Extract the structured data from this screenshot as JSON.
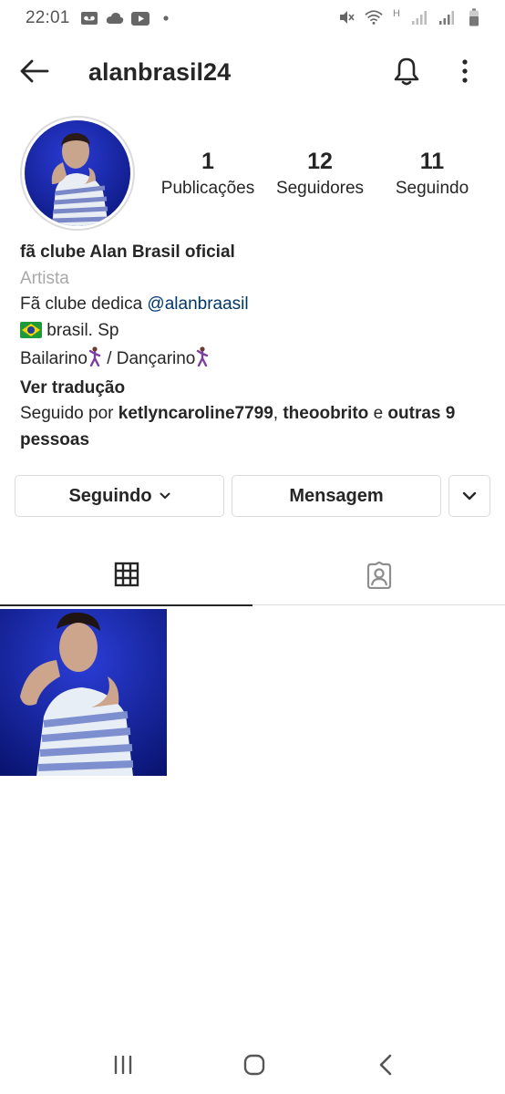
{
  "status_bar": {
    "time": "22:01",
    "network_label": "H"
  },
  "header": {
    "username": "alanbrasil24"
  },
  "stats": [
    {
      "count": "1",
      "label": "Publicações"
    },
    {
      "count": "12",
      "label": "Seguidores"
    },
    {
      "count": "11",
      "label": "Seguindo"
    }
  ],
  "bio": {
    "name": "fã clube Alan Brasil oficial",
    "category": "Artista",
    "line1_prefix": "Fã clube dedica ",
    "line1_mention": "@alanbraasil",
    "line2": " brasil. Sp",
    "line3_a": "Bailarino",
    "line3_b": " / Dançarino",
    "see_translation": "Ver tradução",
    "followed_prefix": "Seguido por ",
    "followed_user1": "ketlyncaroline7799",
    "followed_sep": ", ",
    "followed_user2": "theoobrito",
    "followed_and": " e ",
    "followed_others": "outras 9 pessoas"
  },
  "buttons": {
    "following_label": "Seguindo",
    "message_label": "Mensagem"
  },
  "icons": {
    "back": "arrow-left-icon",
    "bell": "bell-icon",
    "more": "more-vertical-icon",
    "grid": "grid-icon",
    "tagged": "tagged-person-icon"
  },
  "colors": {
    "text": "#262626",
    "muted": "#a8a8a8",
    "link": "#00376b",
    "border": "#dbdbdb"
  }
}
